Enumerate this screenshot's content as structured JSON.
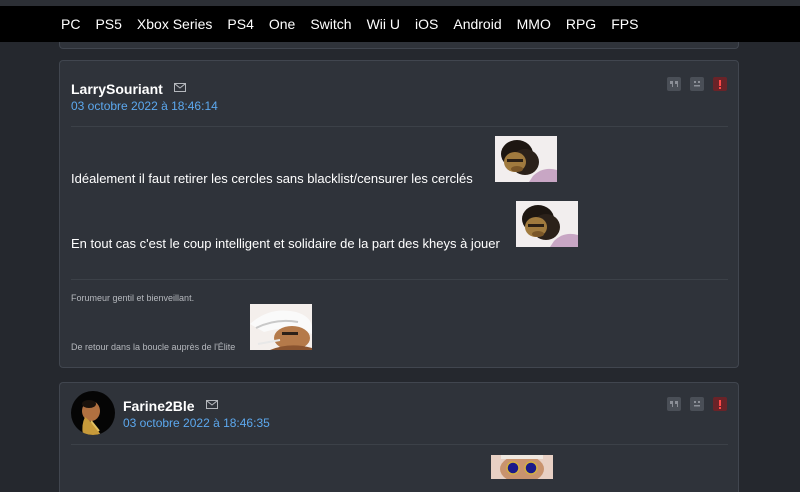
{
  "nav": {
    "items": [
      "PC",
      "PS5",
      "Xbox Series",
      "PS4",
      "One",
      "Switch",
      "Wii U",
      "iOS",
      "Android",
      "MMO",
      "RPG",
      "FPS"
    ]
  },
  "posts": [
    {
      "username": "LarrySouriant",
      "date": "03 octobre 2022 à 18:46:14",
      "message_lines": [
        "Idéalement il faut retirer les cercles sans blacklist/censurer les cerclés",
        "En tout cas c'est le coup intelligent et solidaire de la part des kheys à jouer"
      ],
      "signature_lines": [
        "Forumeur gentil et bienveillant.",
        "De retour dans la boucle auprès de l'Élite"
      ]
    },
    {
      "username": "Farine2Ble",
      "date": "03 octobre 2022 à 18:46:35"
    }
  ],
  "icons": {
    "quote": "quote-icon",
    "mp": "envelope-icon",
    "blacklist": "blacklist-face-icon",
    "report": "alert-icon"
  },
  "colors": {
    "background": "#25282e",
    "navbar": "#000000",
    "card": "#2f333a",
    "card_border": "#41464f",
    "date_link": "#5ca8ee",
    "alert": "#6a2328",
    "alert_glyph": "#ff4a4a"
  }
}
